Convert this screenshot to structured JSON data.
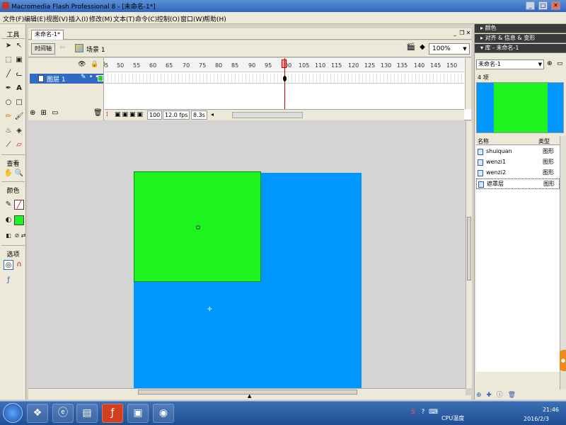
{
  "window": {
    "title": "Macromedia Flash Professional 8 - [未命名-1*]",
    "min": "_",
    "max": "□",
    "close": "✕"
  },
  "menu": [
    "文件(F)",
    "编辑(E)",
    "视图(V)",
    "插入(I)",
    "修改(M)",
    "文本(T)",
    "命令(C)",
    "控制(O)",
    "窗口(W)",
    "帮助(H)"
  ],
  "tools": {
    "title": "工具",
    "view_label": "查看",
    "color_label": "颜色",
    "options_label": "选项"
  },
  "document": {
    "tab_label": "未命名-1*",
    "timeline_button": "时间轴",
    "scene_label": "场景 1",
    "zoom": "100%"
  },
  "timeline": {
    "head_icons": "👁 🔒 □",
    "layer_name": "图层 1",
    "ruler_ticks": [
      "5",
      "50",
      "55",
      "60",
      "65",
      "70",
      "75",
      "80",
      "85",
      "90",
      "95",
      "100",
      "105",
      "110",
      "115",
      "120",
      "125",
      "130",
      "135",
      "140",
      "145",
      "150"
    ],
    "current_frame": "100",
    "fps": "12.0 fps",
    "elapsed": "8.3s"
  },
  "colors": {
    "stage_blue": "#0097ff",
    "rect_green": "#1ef41e",
    "layer_highlight": "#316ac5"
  },
  "panels": {
    "color_header": "颜色",
    "align_header": "对齐 & 信息 & 变形",
    "library_header": "库 - 未命名-1",
    "library_select": "未命名-1",
    "item_count": "4 项",
    "col_name": "名称",
    "col_type": "类型",
    "items": [
      {
        "name": "shuiquan",
        "type": "图形"
      },
      {
        "name": "wenzi1",
        "type": "图形"
      },
      {
        "name": "wenzi2",
        "type": "图形"
      },
      {
        "name": "遮罩层",
        "type": "图形"
      }
    ]
  },
  "taskbar": {
    "cpu_label": "CPU温度",
    "time": "21:46",
    "date": "2016/2/3"
  }
}
